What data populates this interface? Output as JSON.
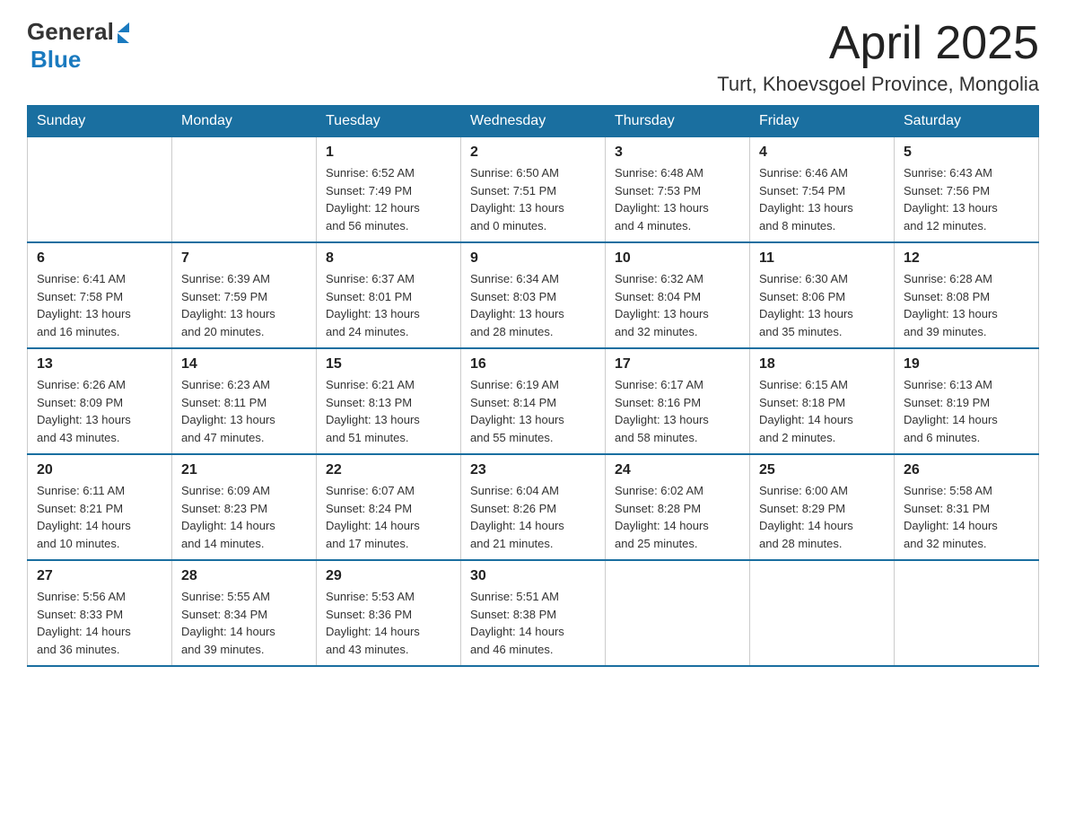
{
  "header": {
    "logo": {
      "general": "General",
      "blue": "Blue"
    },
    "title": "April 2025",
    "subtitle": "Turt, Khoevsgoel Province, Mongolia"
  },
  "calendar": {
    "days_of_week": [
      "Sunday",
      "Monday",
      "Tuesday",
      "Wednesday",
      "Thursday",
      "Friday",
      "Saturday"
    ],
    "weeks": [
      [
        {
          "day": "",
          "info": ""
        },
        {
          "day": "",
          "info": ""
        },
        {
          "day": "1",
          "info": "Sunrise: 6:52 AM\nSunset: 7:49 PM\nDaylight: 12 hours\nand 56 minutes."
        },
        {
          "day": "2",
          "info": "Sunrise: 6:50 AM\nSunset: 7:51 PM\nDaylight: 13 hours\nand 0 minutes."
        },
        {
          "day": "3",
          "info": "Sunrise: 6:48 AM\nSunset: 7:53 PM\nDaylight: 13 hours\nand 4 minutes."
        },
        {
          "day": "4",
          "info": "Sunrise: 6:46 AM\nSunset: 7:54 PM\nDaylight: 13 hours\nand 8 minutes."
        },
        {
          "day": "5",
          "info": "Sunrise: 6:43 AM\nSunset: 7:56 PM\nDaylight: 13 hours\nand 12 minutes."
        }
      ],
      [
        {
          "day": "6",
          "info": "Sunrise: 6:41 AM\nSunset: 7:58 PM\nDaylight: 13 hours\nand 16 minutes."
        },
        {
          "day": "7",
          "info": "Sunrise: 6:39 AM\nSunset: 7:59 PM\nDaylight: 13 hours\nand 20 minutes."
        },
        {
          "day": "8",
          "info": "Sunrise: 6:37 AM\nSunset: 8:01 PM\nDaylight: 13 hours\nand 24 minutes."
        },
        {
          "day": "9",
          "info": "Sunrise: 6:34 AM\nSunset: 8:03 PM\nDaylight: 13 hours\nand 28 minutes."
        },
        {
          "day": "10",
          "info": "Sunrise: 6:32 AM\nSunset: 8:04 PM\nDaylight: 13 hours\nand 32 minutes."
        },
        {
          "day": "11",
          "info": "Sunrise: 6:30 AM\nSunset: 8:06 PM\nDaylight: 13 hours\nand 35 minutes."
        },
        {
          "day": "12",
          "info": "Sunrise: 6:28 AM\nSunset: 8:08 PM\nDaylight: 13 hours\nand 39 minutes."
        }
      ],
      [
        {
          "day": "13",
          "info": "Sunrise: 6:26 AM\nSunset: 8:09 PM\nDaylight: 13 hours\nand 43 minutes."
        },
        {
          "day": "14",
          "info": "Sunrise: 6:23 AM\nSunset: 8:11 PM\nDaylight: 13 hours\nand 47 minutes."
        },
        {
          "day": "15",
          "info": "Sunrise: 6:21 AM\nSunset: 8:13 PM\nDaylight: 13 hours\nand 51 minutes."
        },
        {
          "day": "16",
          "info": "Sunrise: 6:19 AM\nSunset: 8:14 PM\nDaylight: 13 hours\nand 55 minutes."
        },
        {
          "day": "17",
          "info": "Sunrise: 6:17 AM\nSunset: 8:16 PM\nDaylight: 13 hours\nand 58 minutes."
        },
        {
          "day": "18",
          "info": "Sunrise: 6:15 AM\nSunset: 8:18 PM\nDaylight: 14 hours\nand 2 minutes."
        },
        {
          "day": "19",
          "info": "Sunrise: 6:13 AM\nSunset: 8:19 PM\nDaylight: 14 hours\nand 6 minutes."
        }
      ],
      [
        {
          "day": "20",
          "info": "Sunrise: 6:11 AM\nSunset: 8:21 PM\nDaylight: 14 hours\nand 10 minutes."
        },
        {
          "day": "21",
          "info": "Sunrise: 6:09 AM\nSunset: 8:23 PM\nDaylight: 14 hours\nand 14 minutes."
        },
        {
          "day": "22",
          "info": "Sunrise: 6:07 AM\nSunset: 8:24 PM\nDaylight: 14 hours\nand 17 minutes."
        },
        {
          "day": "23",
          "info": "Sunrise: 6:04 AM\nSunset: 8:26 PM\nDaylight: 14 hours\nand 21 minutes."
        },
        {
          "day": "24",
          "info": "Sunrise: 6:02 AM\nSunset: 8:28 PM\nDaylight: 14 hours\nand 25 minutes."
        },
        {
          "day": "25",
          "info": "Sunrise: 6:00 AM\nSunset: 8:29 PM\nDaylight: 14 hours\nand 28 minutes."
        },
        {
          "day": "26",
          "info": "Sunrise: 5:58 AM\nSunset: 8:31 PM\nDaylight: 14 hours\nand 32 minutes."
        }
      ],
      [
        {
          "day": "27",
          "info": "Sunrise: 5:56 AM\nSunset: 8:33 PM\nDaylight: 14 hours\nand 36 minutes."
        },
        {
          "day": "28",
          "info": "Sunrise: 5:55 AM\nSunset: 8:34 PM\nDaylight: 14 hours\nand 39 minutes."
        },
        {
          "day": "29",
          "info": "Sunrise: 5:53 AM\nSunset: 8:36 PM\nDaylight: 14 hours\nand 43 minutes."
        },
        {
          "day": "30",
          "info": "Sunrise: 5:51 AM\nSunset: 8:38 PM\nDaylight: 14 hours\nand 46 minutes."
        },
        {
          "day": "",
          "info": ""
        },
        {
          "day": "",
          "info": ""
        },
        {
          "day": "",
          "info": ""
        }
      ]
    ]
  }
}
